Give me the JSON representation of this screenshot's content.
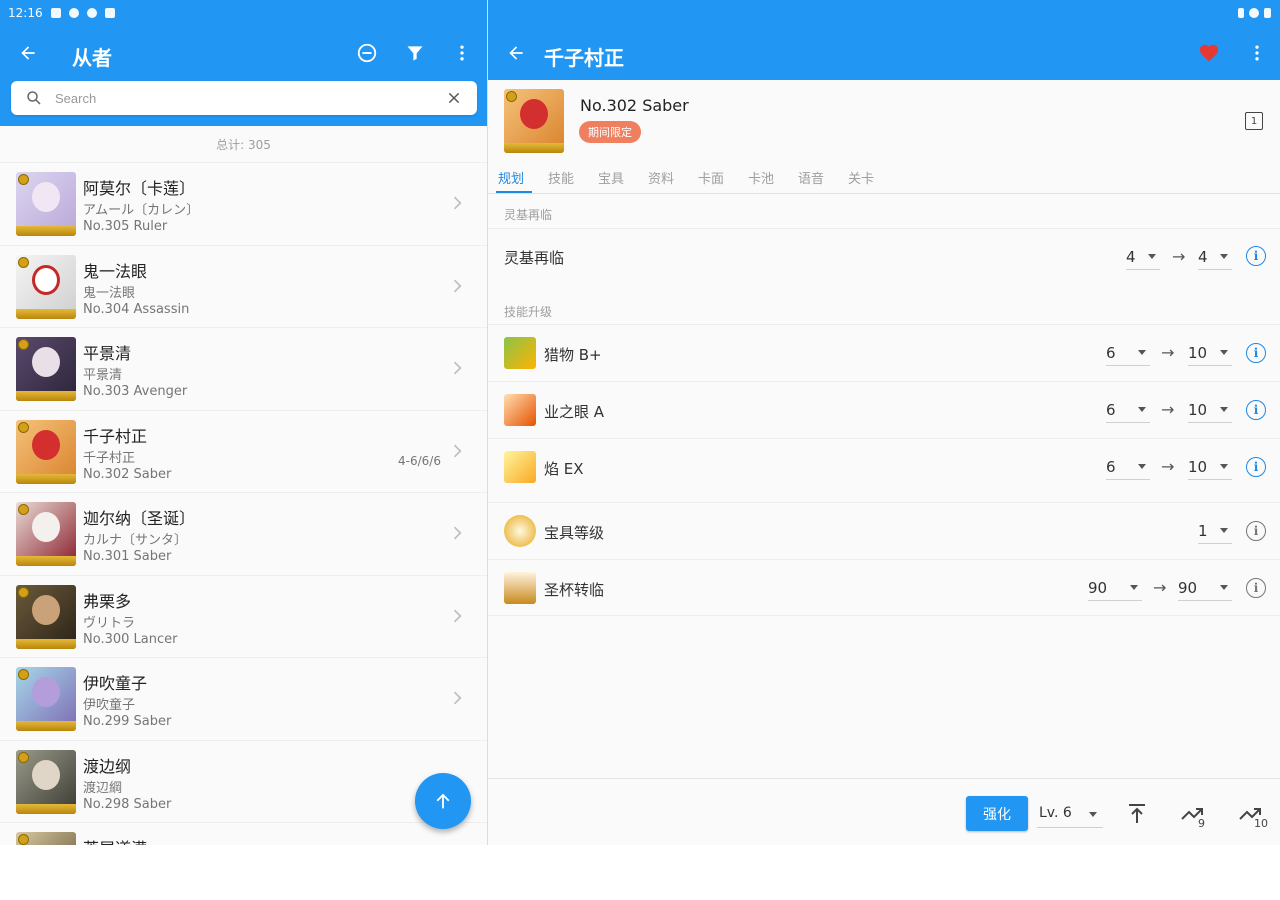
{
  "colors": {
    "primary": "#2196f3",
    "accent_blue": "#1e88e5",
    "limited_chip": "#ef7f5f",
    "favorite": "#e53935"
  },
  "status_bar": {
    "time": "12:16"
  },
  "left": {
    "title": "从者",
    "back_icon": "arrow-left-icon",
    "actions": [
      "remove-circle-icon",
      "filter-icon",
      "more-vert-icon"
    ],
    "search": {
      "placeholder": "Search",
      "value": ""
    },
    "total": "总计: 305",
    "servants": [
      {
        "name": "阿莫尔〔卡莲〕",
        "jp": "アムール〔カレン〕",
        "no": "No.305 Ruler",
        "progress": ""
      },
      {
        "name": "鬼一法眼",
        "jp": "鬼一法眼",
        "no": "No.304 Assassin",
        "progress": ""
      },
      {
        "name": "平景清",
        "jp": "平景清",
        "no": "No.303 Avenger",
        "progress": ""
      },
      {
        "name": "千子村正",
        "jp": "千子村正",
        "no": "No.302 Saber",
        "progress": "4-6/6/6"
      },
      {
        "name": "迦尔纳〔圣诞〕",
        "jp": "カルナ〔サンタ〕",
        "no": "No.301 Saber",
        "progress": ""
      },
      {
        "name": "弗栗多",
        "jp": "ヴリトラ",
        "no": "No.300 Lancer",
        "progress": ""
      },
      {
        "name": "伊吹童子",
        "jp": "伊吹童子",
        "no": "No.299 Saber",
        "progress": ""
      },
      {
        "name": "渡边纲",
        "jp": "渡辺綱",
        "no": "No.298 Saber",
        "progress": ""
      },
      {
        "name": "芦屋道满",
        "jp": "",
        "no": "",
        "progress": ""
      }
    ],
    "fab_icon": "arrow-up-icon"
  },
  "right": {
    "title": "千子村正",
    "detail": {
      "title": "No.302  Saber",
      "chip": "期间限定",
      "corner": "1"
    },
    "tabs": [
      "规划",
      "技能",
      "宝具",
      "资料",
      "卡面",
      "卡池",
      "语音",
      "关卡"
    ],
    "ascension_section": "灵基再临",
    "ascension": {
      "label": "灵基再临",
      "from": "4",
      "to": "4"
    },
    "skill_section": "技能升级",
    "skills": [
      {
        "label": "猎物 B+",
        "from": "6",
        "to": "10"
      },
      {
        "label": "业之眼 A",
        "from": "6",
        "to": "10"
      },
      {
        "label": "焰 EX",
        "from": "6",
        "to": "10"
      }
    ],
    "np": {
      "label": "宝具等级",
      "value": "1"
    },
    "grail": {
      "label": "圣杯转临",
      "from": "90",
      "to": "90"
    },
    "arrow": "→",
    "bottom": {
      "enhance": "强化",
      "level": "Lv. 6",
      "sub9": "9",
      "sub10": "10"
    }
  }
}
